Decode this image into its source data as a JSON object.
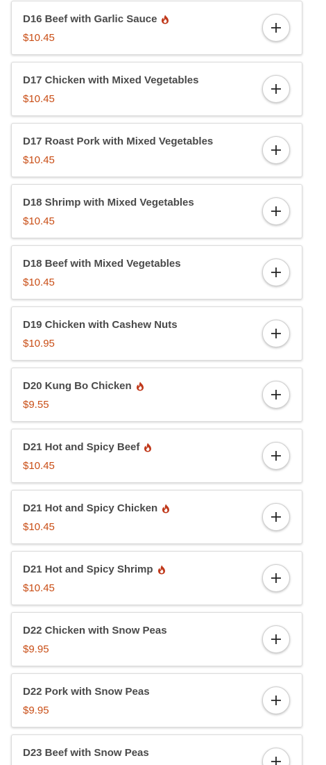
{
  "menu": {
    "items": [
      {
        "name": "D16 Beef with Garlic Sauce",
        "price": "$10.45",
        "spicy": true
      },
      {
        "name": "D17 Chicken with Mixed Vegetables",
        "price": "$10.45",
        "spicy": false
      },
      {
        "name": "D17 Roast Pork with Mixed Vegetables",
        "price": "$10.45",
        "spicy": false
      },
      {
        "name": "D18 Shrimp with Mixed Vegetables",
        "price": "$10.45",
        "spicy": false
      },
      {
        "name": "D18 Beef with Mixed Vegetables",
        "price": "$10.45",
        "spicy": false
      },
      {
        "name": "D19 Chicken with Cashew Nuts",
        "price": "$10.95",
        "spicy": false
      },
      {
        "name": "D20 Kung Bo Chicken",
        "price": "$9.55",
        "spicy": true
      },
      {
        "name": "D21 Hot and Spicy Beef",
        "price": "$10.45",
        "spicy": true
      },
      {
        "name": "D21 Hot and Spicy Chicken",
        "price": "$10.45",
        "spicy": true
      },
      {
        "name": "D21 Hot and Spicy Shrimp",
        "price": "$10.45",
        "spicy": true
      },
      {
        "name": "D22 Chicken with Snow Peas",
        "price": "$9.95",
        "spicy": false
      },
      {
        "name": "D22 Pork with Snow Peas",
        "price": "$9.95",
        "spicy": false
      },
      {
        "name": "D23 Beef with Snow Peas",
        "price": "",
        "spicy": false
      }
    ]
  },
  "icons": {
    "spicy": "flame-icon",
    "add": "plus-icon"
  },
  "colors": {
    "price": "#c94e16",
    "spicy_icon": "#c0391b",
    "name_text": "#4a4a4a"
  }
}
